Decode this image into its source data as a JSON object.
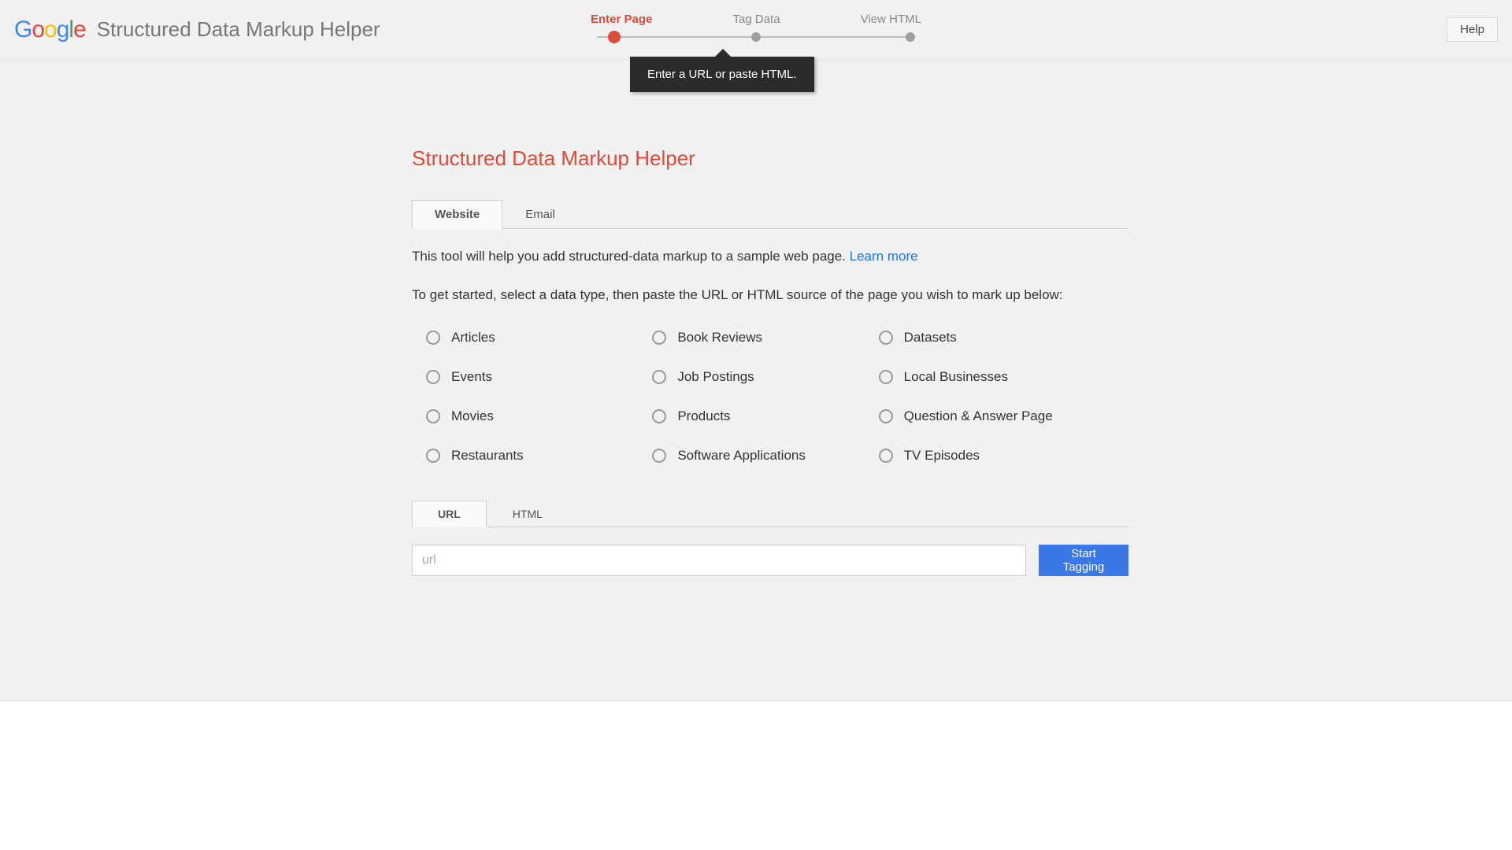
{
  "header": {
    "app_title": "Structured Data Markup Helper",
    "help_label": "Help"
  },
  "progress": {
    "steps": [
      "Enter Page",
      "Tag Data",
      "View HTML"
    ],
    "active_index": 0,
    "tooltip": "Enter a URL or paste HTML."
  },
  "main": {
    "heading": "Structured Data Markup Helper",
    "tabs": {
      "website": "Website",
      "email": "Email"
    },
    "intro_text": "This tool will help you add structured-data markup to a sample web page. ",
    "learn_more": "Learn more",
    "instruction": "To get started, select a data type, then paste the URL or HTML source of the page you wish to mark up below:",
    "data_types": [
      "Articles",
      "Book Reviews",
      "Datasets",
      "Events",
      "Job Postings",
      "Local Businesses",
      "Movies",
      "Products",
      "Question & Answer Page",
      "Restaurants",
      "Software Applications",
      "TV Episodes"
    ],
    "input_tabs": {
      "url": "URL",
      "html": "HTML"
    },
    "url_placeholder": "url",
    "start_button": "Start Tagging"
  }
}
